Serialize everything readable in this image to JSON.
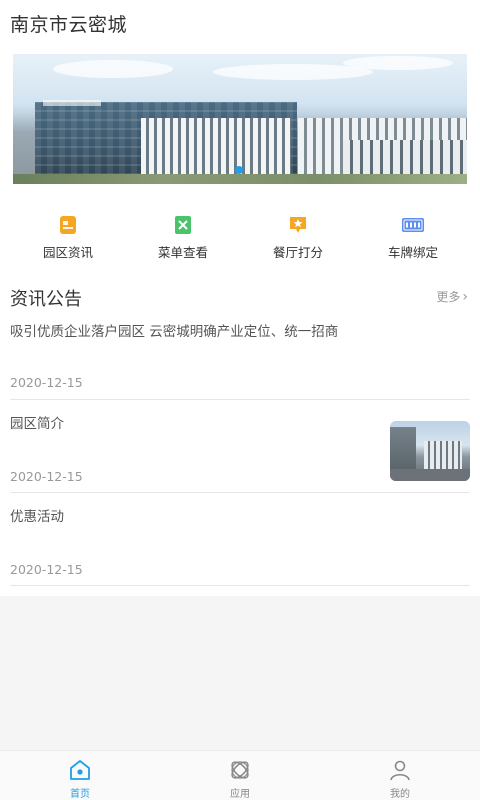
{
  "app": {
    "title": "南京市云密城"
  },
  "banner": {
    "active_dot_color": "#1e9fe6"
  },
  "quick_menu": [
    {
      "label": "园区资讯",
      "icon": "news-icon",
      "color": "#f5a623"
    },
    {
      "label": "菜单查看",
      "icon": "menu-book-icon",
      "color": "#4cc36a"
    },
    {
      "label": "餐厅打分",
      "icon": "rating-star-icon",
      "color": "#f5a623"
    },
    {
      "label": "车牌绑定",
      "icon": "license-plate-icon",
      "color": "#5b8ef0"
    }
  ],
  "news_section": {
    "title": "资讯公告",
    "more_label": "更多",
    "items": [
      {
        "title": "吸引优质企业落户园区 云密城明确产业定位、统一招商",
        "date": "2020-12-15"
      },
      {
        "title": "园区简介",
        "date": "2020-12-15"
      },
      {
        "title": "优惠活动",
        "date": "2020-12-15"
      }
    ]
  },
  "tabbar": {
    "active_color": "#1e9fe6",
    "items": [
      {
        "label": "首页",
        "icon": "home-icon"
      },
      {
        "label": "应用",
        "icon": "apps-orbit-icon"
      },
      {
        "label": "我的",
        "icon": "user-icon"
      }
    ]
  }
}
